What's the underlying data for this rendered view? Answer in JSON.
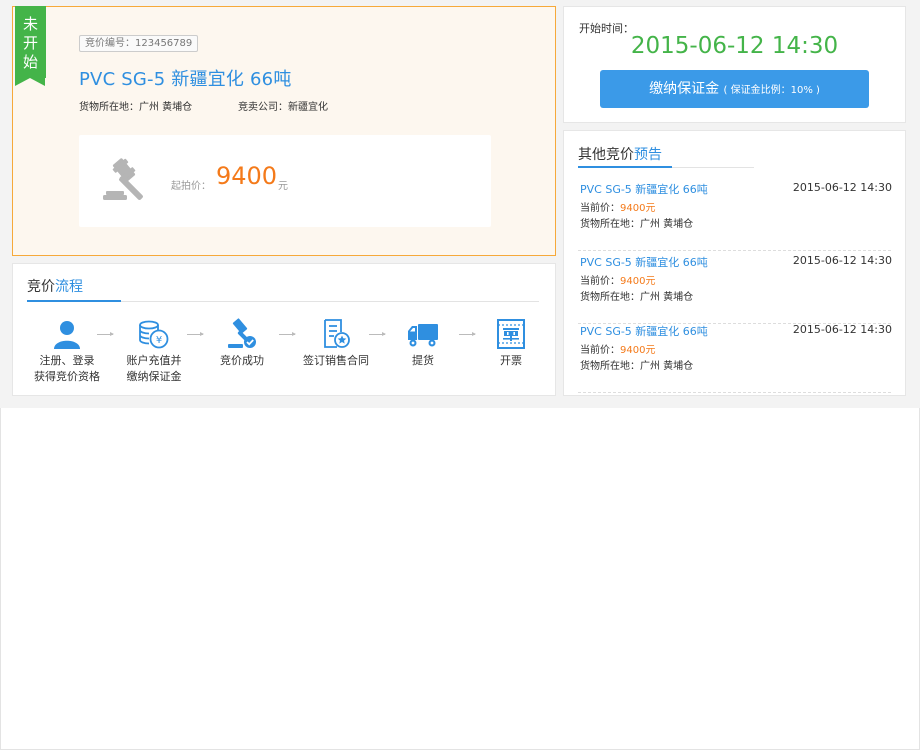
{
  "colors": {
    "accent": "#2f8fe0",
    "price": "#f47a1a",
    "status_green": "#44b449",
    "button_blue": "#3b9ae8",
    "card_border_active": "#f6a93a"
  },
  "lot": {
    "status_chars": [
      "未",
      "开",
      "始"
    ],
    "number": "竞价编号：123456789",
    "title": "PVC SG-5 新疆宜化 66吨",
    "location": "货物所在地：广州  黄埔仓",
    "seller": "竞卖公司：新疆宜化",
    "price_label": "起拍价：",
    "price_value": "9400",
    "price_unit": "元",
    "icon": "gavel-icon"
  },
  "start": {
    "label": "开始时间：",
    "value": "2015-06-12 14:30",
    "deposit_label": "缴纳保证金",
    "deposit_note": "( 保证金比例：10% )"
  },
  "flow": {
    "title": "竞价",
    "title_accent": "流程",
    "steps": [
      {
        "line1": "注册、登录",
        "line2": "获得竞价资格",
        "icon": "user-icon"
      },
      {
        "line1": "账户充值并",
        "line2": "缴纳保证金",
        "icon": "coins-icon"
      },
      {
        "line1": "竞价成功",
        "line2": "",
        "icon": "gavel-check-icon"
      },
      {
        "line1": "签订销售合同",
        "line2": "",
        "icon": "contract-icon"
      },
      {
        "line1": "提货",
        "line2": "",
        "icon": "truck-icon"
      },
      {
        "line1": "开票",
        "line2": "",
        "icon": "invoice-icon"
      }
    ]
  },
  "other": {
    "title": "其他竞价",
    "title_accent": "预告",
    "items": [
      {
        "title": "PVC SG-5 新疆宜化 66吨",
        "time": "2015-06-12 14:30",
        "price_label": "当前价：",
        "price": "9400元",
        "location": "货物所在地：广州  黄埔仓"
      },
      {
        "title": "PVC SG-5 新疆宜化 66吨",
        "time": "2015-06-12 14:30",
        "price_label": "当前价：",
        "price": "9400元",
        "location": "货物所在地：广州  黄埔仓"
      },
      {
        "title": "PVC SG-5 新疆宜化 66吨",
        "time": "2015-06-12 14:30",
        "price_label": "当前价：",
        "price": "9400元",
        "location": "货物所在地：广州  黄埔仓"
      }
    ]
  }
}
